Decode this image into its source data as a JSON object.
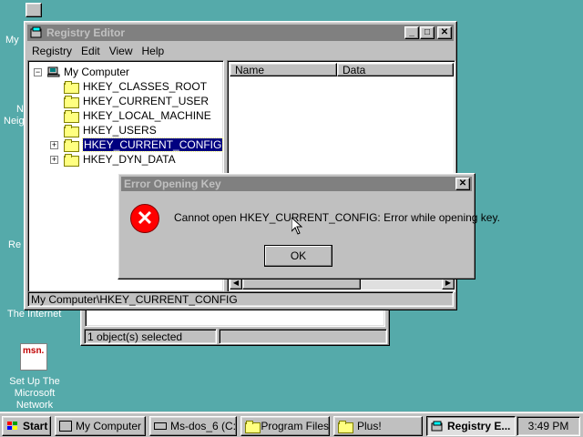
{
  "desktop": {
    "icon_labels": [
      "My",
      "N",
      "Neig",
      "Re",
      "The Internet",
      "Set Up The Microsoft Network"
    ],
    "msn_logo": "msn."
  },
  "regedit": {
    "title": "Registry Editor",
    "menu": [
      "Registry",
      "Edit",
      "View",
      "Help"
    ],
    "tree": {
      "root": "My Computer",
      "keys": [
        "HKEY_CLASSES_ROOT",
        "HKEY_CURRENT_USER",
        "HKEY_LOCAL_MACHINE",
        "HKEY_USERS",
        "HKEY_CURRENT_CONFIG",
        "HKEY_DYN_DATA"
      ],
      "selected_index": 4
    },
    "columns": [
      "Name",
      "Data"
    ],
    "status": "My Computer\\HKEY_CURRENT_CONFIG"
  },
  "explorer_status": "1 object(s) selected",
  "dialog": {
    "title": "Error Opening Key",
    "message": "Cannot open HKEY_CURRENT_CONFIG:  Error while opening key.",
    "ok_label": "OK"
  },
  "taskbar": {
    "start": "Start",
    "buttons": [
      "My Computer",
      "Ms-dos_6 (C:)",
      "Program Files",
      "Plus!",
      "Registry E..."
    ],
    "active_index": 4,
    "clock": "3:49 PM"
  },
  "colors": {
    "desktop": "#55aaaa",
    "titlebar_active": "#000080",
    "titlebar_inactive": "#808080",
    "face": "#c0c0c0",
    "error": "#ff0000"
  }
}
